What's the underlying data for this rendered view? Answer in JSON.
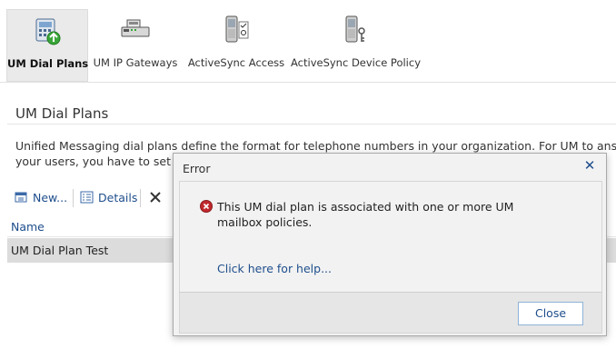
{
  "ribbon": {
    "tabs": [
      {
        "label": "UM Dial Plans",
        "icon": "um-dial-plans-icon",
        "active": true
      },
      {
        "label": "UM IP Gateways",
        "icon": "ip-gateway-icon",
        "active": false
      },
      {
        "label": "ActiveSync Access",
        "icon": "mobile-device-icon",
        "active": false
      },
      {
        "label": "ActiveSync Device Policy",
        "icon": "mobile-policy-icon",
        "active": false
      }
    ]
  },
  "page": {
    "title": "UM Dial Plans",
    "description_line1": "Unified Messaging dial plans define the format for telephone numbers in your organization. For UM to answer ca",
    "description_line2": "your users, you have to set up"
  },
  "toolbar": {
    "new_label": "New...",
    "details_label": "Details"
  },
  "grid": {
    "header_name": "Name",
    "rows": [
      {
        "name": "UM Dial Plan Test"
      }
    ]
  },
  "dialog": {
    "title": "Error",
    "message": "This UM dial plan is associated with one or more UM mailbox policies.",
    "help_link": "Click here for help...",
    "close_button": "Close"
  },
  "colors": {
    "link": "#1e4e8c",
    "error_red": "#c0282d",
    "selected_row": "#dcdcdc"
  }
}
